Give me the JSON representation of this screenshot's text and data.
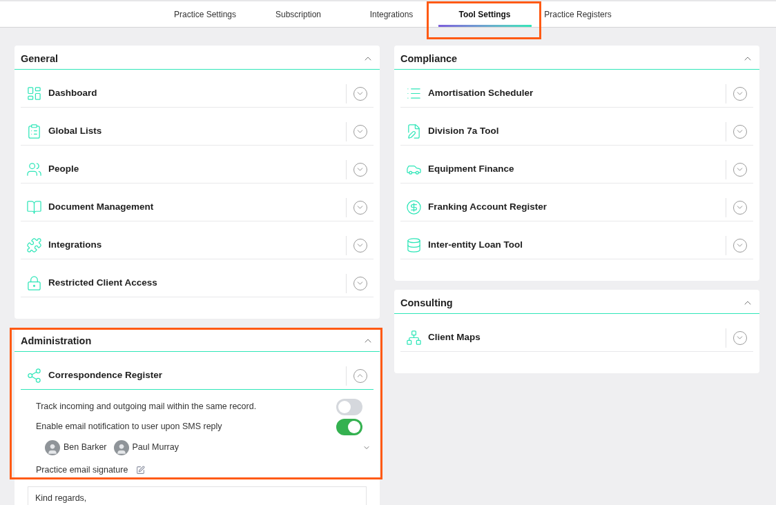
{
  "tabs": [
    {
      "label": "Practice Settings",
      "selected": false,
      "highlighted": false
    },
    {
      "label": "Subscription",
      "selected": false,
      "highlighted": false
    },
    {
      "label": "Integrations",
      "selected": false,
      "highlighted": false
    },
    {
      "label": "Tool Settings",
      "selected": true,
      "highlighted": true
    },
    {
      "label": "Practice Registers",
      "selected": false,
      "highlighted": false
    }
  ],
  "left_column": [
    {
      "title": "General",
      "expanded": true,
      "highlighted": false,
      "items": [
        {
          "label": "Dashboard",
          "expanded": false
        },
        {
          "label": "Global Lists",
          "expanded": false
        },
        {
          "label": "People",
          "expanded": false
        },
        {
          "label": "Document Management",
          "expanded": false
        },
        {
          "label": "Integrations",
          "expanded": false
        },
        {
          "label": "Restricted Client Access",
          "expanded": false
        }
      ]
    },
    {
      "title": "Administration",
      "expanded": true,
      "highlighted": true,
      "items": [
        {
          "label": "Correspondence Register",
          "expanded": true,
          "settings": [
            {
              "label": "Track incoming and outgoing mail within the same record.",
              "on": false
            },
            {
              "label": "Enable email notification to user upon SMS reply",
              "on": true
            }
          ],
          "users": [
            "Ben Barker",
            "Paul Murray"
          ],
          "signature_label": "Practice email signature",
          "signature_text": "Kind regards,"
        }
      ]
    }
  ],
  "right_column": [
    {
      "title": "Compliance",
      "expanded": true,
      "highlighted": false,
      "items": [
        {
          "label": "Amortisation Scheduler",
          "expanded": false
        },
        {
          "label": "Division 7a Tool",
          "expanded": false
        },
        {
          "label": "Equipment Finance",
          "expanded": false
        },
        {
          "label": "Franking Account Register",
          "expanded": false
        },
        {
          "label": "Inter-entity Loan Tool",
          "expanded": false
        }
      ]
    },
    {
      "title": "Consulting",
      "expanded": true,
      "highlighted": false,
      "items": [
        {
          "label": "Client Maps",
          "expanded": false
        }
      ]
    }
  ]
}
